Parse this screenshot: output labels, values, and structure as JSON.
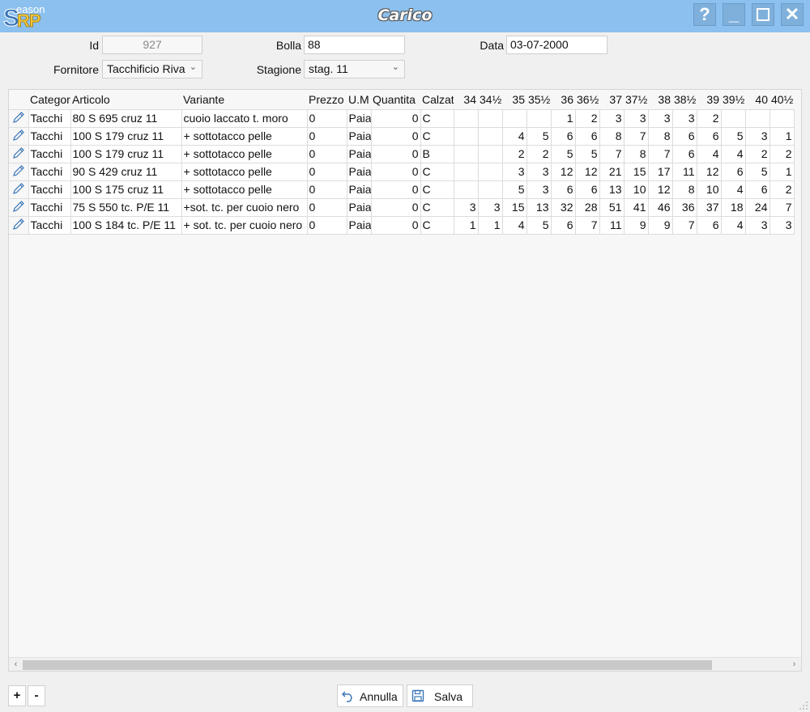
{
  "window": {
    "title": "Carico",
    "logo_letter": "S",
    "logo_suffix": "RP",
    "logo_small": "eason",
    "help": "?",
    "minimize": "_",
    "close": "✕"
  },
  "form": {
    "id_label": "Id",
    "id_value": "927",
    "bolla_label": "Bolla",
    "bolla_value": "88",
    "data_label": "Data",
    "data_value": "03-07-2000",
    "fornitore_label": "Fornitore",
    "fornitore_value": "Tacchificio Riva",
    "stagione_label": "Stagione",
    "stagione_value": "stag. 11"
  },
  "grid": {
    "columns": [
      "",
      "Categor",
      "Articolo",
      "Variante",
      "Prezzo",
      "U.M",
      "Quantita",
      "Calzat",
      "34",
      "34½",
      "35",
      "35½",
      "36",
      "36½",
      "37",
      "37½",
      "38",
      "38½",
      "39",
      "39½",
      "40",
      "40½"
    ],
    "rows": [
      [
        "Tacchi",
        "80 S 695 cruz 11",
        "cuoio laccato t. moro",
        "0",
        "Paia",
        "0",
        "C",
        "",
        "",
        "",
        "",
        "1",
        "2",
        "3",
        "3",
        "3",
        "3",
        "2",
        "",
        "",
        ""
      ],
      [
        "Tacchi",
        "100 S 179 cruz 11",
        "+ sottotacco pelle",
        "0",
        "Paia",
        "0",
        "C",
        "",
        "",
        "4",
        "5",
        "6",
        "6",
        "8",
        "7",
        "8",
        "6",
        "6",
        "5",
        "3",
        "1"
      ],
      [
        "Tacchi",
        "100 S 179 cruz 11",
        "+ sottotacco pelle",
        "0",
        "Paia",
        "0",
        "B",
        "",
        "",
        "2",
        "2",
        "5",
        "5",
        "7",
        "8",
        "7",
        "6",
        "4",
        "4",
        "2",
        "2"
      ],
      [
        "Tacchi",
        "90 S 429 cruz 11",
        "+ sottotacco pelle",
        "0",
        "Paia",
        "0",
        "C",
        "",
        "",
        "3",
        "3",
        "12",
        "12",
        "21",
        "15",
        "17",
        "11",
        "12",
        "6",
        "5",
        "1"
      ],
      [
        "Tacchi",
        "100 S 175 cruz 11",
        "+ sottotacco pelle",
        "0",
        "Paia",
        "0",
        "C",
        "",
        "",
        "5",
        "3",
        "6",
        "6",
        "13",
        "10",
        "12",
        "8",
        "10",
        "4",
        "6",
        "2"
      ],
      [
        "Tacchi",
        "75 S 550 tc. P/E 11",
        "+sot. tc. per cuoio nero",
        "0",
        "Paia",
        "0",
        "C",
        "3",
        "3",
        "15",
        "13",
        "32",
        "28",
        "51",
        "41",
        "46",
        "36",
        "37",
        "18",
        "24",
        "7"
      ],
      [
        "Tacchi",
        "100 S 184 tc. P/E 11",
        "+ sot. tc. per cuoio nero",
        "0",
        "Paia",
        "0",
        "C",
        "1",
        "1",
        "4",
        "5",
        "6",
        "7",
        "11",
        "9",
        "9",
        "7",
        "6",
        "4",
        "3",
        "3"
      ]
    ],
    "scroll_left": "‹",
    "scroll_right": "›"
  },
  "footer": {
    "add": "+",
    "remove": "-",
    "cancel": "Annulla",
    "save": "Salva"
  },
  "colors": {
    "titlebar": "#8cc0ee",
    "background": "#f0f0f0",
    "accent": "#3c77b8"
  }
}
